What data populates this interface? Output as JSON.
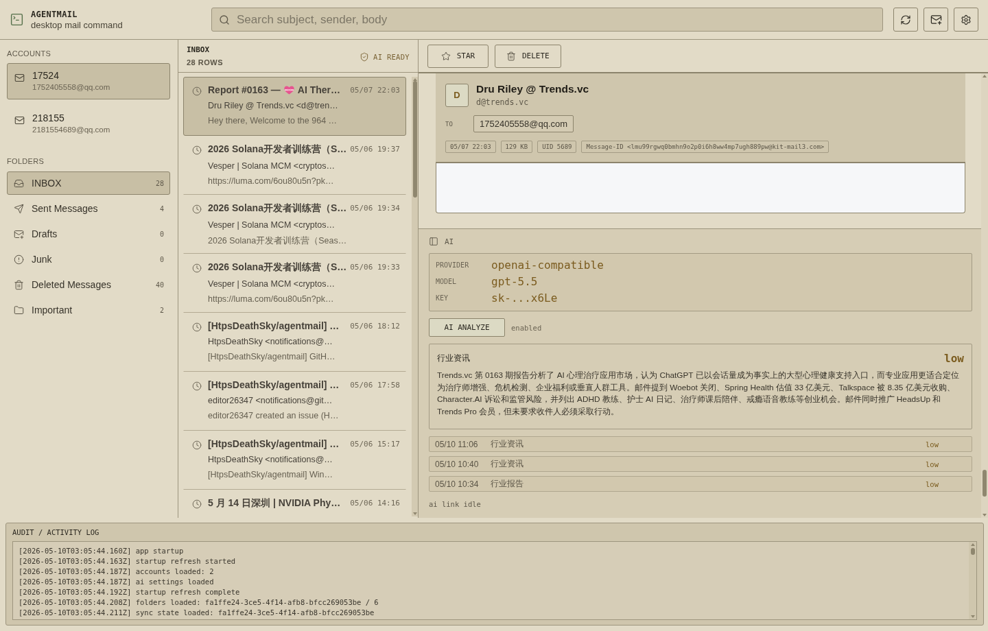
{
  "app": {
    "title": "AGENTMAIL",
    "subtitle": "desktop mail command"
  },
  "search": {
    "placeholder": "Search subject, sender, body"
  },
  "sidebar": {
    "accounts_label": "ACCOUNTS",
    "accounts": [
      {
        "name": "17524",
        "email": "1752405558@qq.com",
        "selected": true
      },
      {
        "name": "218155",
        "email": "2181554689@qq.com",
        "selected": false
      }
    ],
    "folders_label": "FOLDERS",
    "folders": [
      {
        "kind": "inbox",
        "name": "INBOX",
        "count": "28",
        "selected": true
      },
      {
        "kind": "sent",
        "name": "Sent Messages",
        "count": "4",
        "selected": false
      },
      {
        "kind": "drafts",
        "name": "Drafts",
        "count": "0",
        "selected": false
      },
      {
        "kind": "junk",
        "name": "Junk",
        "count": "0",
        "selected": false
      },
      {
        "kind": "trash",
        "name": "Deleted Messages",
        "count": "40",
        "selected": false
      },
      {
        "kind": "folder",
        "name": "Important",
        "count": "2",
        "selected": false
      }
    ]
  },
  "message_list": {
    "title": "INBOX",
    "count": "28 ROWS",
    "ai_status": "AI READY",
    "messages": [
      {
        "subject": "Report #0163 —",
        "emoji": true,
        "subject_tail": "AI Ther…",
        "date": "05/07 22:03",
        "sender": "Dru Riley @ Trends.vc <d@tren…",
        "preview": "Hey there, Welcome to the 964 …",
        "selected": true
      },
      {
        "subject": "2026 Solana开发者训练营（S…",
        "date": "05/06 19:37",
        "sender": "Vesper | Solana MCM <cryptos…",
        "preview": "https://luma.com/6ou80u5n?pk…",
        "selected": false
      },
      {
        "subject": "2026 Solana开发者训练营（S…",
        "date": "05/06 19:34",
        "sender": "Vesper | Solana MCM <cryptos…",
        "preview": "2026 Solana开发者训练营（Seas…",
        "selected": false
      },
      {
        "subject": "2026 Solana开发者训练营（S…",
        "date": "05/06 19:33",
        "sender": "Vesper | Solana MCM <cryptos…",
        "preview": "https://luma.com/6ou80u5n?pk…",
        "selected": false
      },
      {
        "subject": "[HtpsDeathSky/agentmail] …",
        "date": "05/06 18:12",
        "sender": "HtpsDeathSky <notifications@…",
        "preview": "[HtpsDeathSky/agentmail] GitH…",
        "selected": false
      },
      {
        "subject": "[HtpsDeathSky/agentmail] …",
        "date": "05/06 17:58",
        "sender": "editor26347 <notifications@git…",
        "preview": "editor26347 created an issue (H…",
        "selected": false
      },
      {
        "subject": "[HtpsDeathSky/agentmail] …",
        "date": "05/06 15:17",
        "sender": "HtpsDeathSky <notifications@…",
        "preview": "[HtpsDeathSky/agentmail] Win…",
        "selected": false
      },
      {
        "subject": "5 月 14 日深圳 | NVIDIA Phy…",
        "date": "05/06 14:16",
        "selected": false
      }
    ]
  },
  "reader": {
    "actions": [
      {
        "kind": "star",
        "label": "STAR"
      },
      {
        "kind": "delete",
        "label": "DELETE"
      }
    ],
    "header": {
      "avatar": "D",
      "name": "Dru Riley @ Trends.vc",
      "email": "d@trends.vc",
      "to_label": "TO",
      "to": "1752405558@qq.com",
      "meta": [
        "05/07 22:03",
        "129 KB",
        "UID 5689",
        "Message-ID <lmu99rgwq0bmhn9o2p0i6h8ww4mp7ugh889pw@kit-mail3.com>"
      ]
    }
  },
  "ai": {
    "title": "AI",
    "settings": [
      {
        "label": "PROVIDER",
        "value": "openai-compatible"
      },
      {
        "label": "MODEL",
        "value": "gpt-5.5"
      },
      {
        "label": "KEY",
        "value": "sk-...x6Le"
      }
    ],
    "analyze_button": "AI ANALYZE",
    "status": "enabled",
    "analysis": {
      "category": "行业资讯",
      "priority": "low",
      "summary": "Trends.vc 第 0163 期报告分析了 AI 心理治疗应用市场，认为 ChatGPT 已以会话量成为事实上的大型心理健康支持入口，而专业应用更适合定位为治疗师增强、危机检测、企业福利或垂直人群工具。邮件提到 Woebot 关闭、Spring Health 估值 33 亿美元、Talkspace 被 8.35 亿美元收购、Character.AI 诉讼和监管风险，并列出 ADHD 教练、护士 AI 日记、治疗师课后陪伴、戒瘾语音教练等创业机会。邮件同时推广 HeadsUp 和 Trends Pro 会员，但未要求收件人必须采取行动。"
    },
    "history": [
      {
        "time": "05/10 11:06",
        "category": "行业资讯",
        "priority": "low"
      },
      {
        "time": "05/10 10:40",
        "category": "行业资讯",
        "priority": "low"
      },
      {
        "time": "05/10 10:34",
        "category": "行业报告",
        "priority": "low"
      }
    ],
    "link_status": "ai link idle"
  },
  "log": {
    "title": "AUDIT / ACTIVITY LOG",
    "lines": [
      "[2026-05-10T03:05:44.160Z] app startup",
      "[2026-05-10T03:05:44.163Z] startup refresh started",
      "[2026-05-10T03:05:44.187Z] accounts loaded: 2",
      "[2026-05-10T03:05:44.187Z] ai settings loaded",
      "[2026-05-10T03:05:44.192Z] startup refresh complete",
      "[2026-05-10T03:05:44.208Z] folders loaded: fa1ffe24-3ce5-4f14-afb8-bfcc269053be / 6",
      "[2026-05-10T03:05:44.211Z] sync state loaded: fa1ffe24-3ce5-4f14-afb8-bfcc269053be"
    ]
  }
}
